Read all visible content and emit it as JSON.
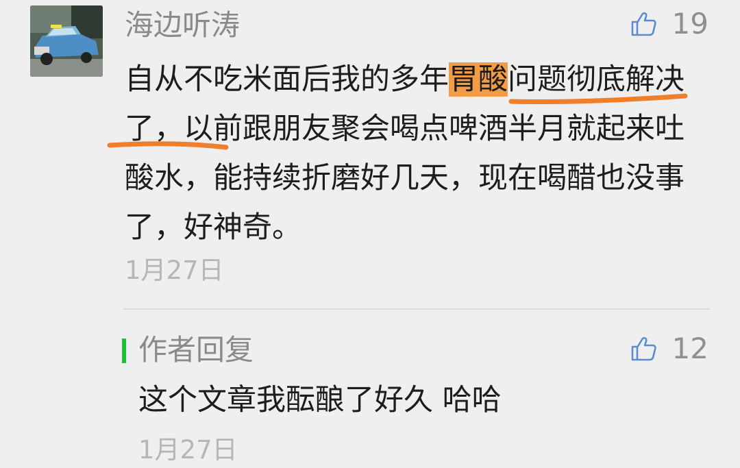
{
  "comment": {
    "nickname": "海边听涛",
    "like_count": "19",
    "text_before": "自从不吃米面后我的多年",
    "text_highlight": "胃酸",
    "text_after": "问题彻底解决了，以前跟朋友聚会喝点啤酒半月就起来吐酸水，能持续折磨好几天，现在喝醋也没事了，好神奇。",
    "date": "1月27日",
    "highlight_color": "#f49c45",
    "underline_color": "#f07f2c"
  },
  "reply": {
    "title": "作者回复",
    "like_count": "12",
    "text": "这个文章我酝酿了好久  哈哈",
    "date": "1月27日",
    "bar_color": "#1fbf3a"
  },
  "icons": {
    "avatar": "car-photo-avatar",
    "like": "thumbs-up-icon"
  }
}
